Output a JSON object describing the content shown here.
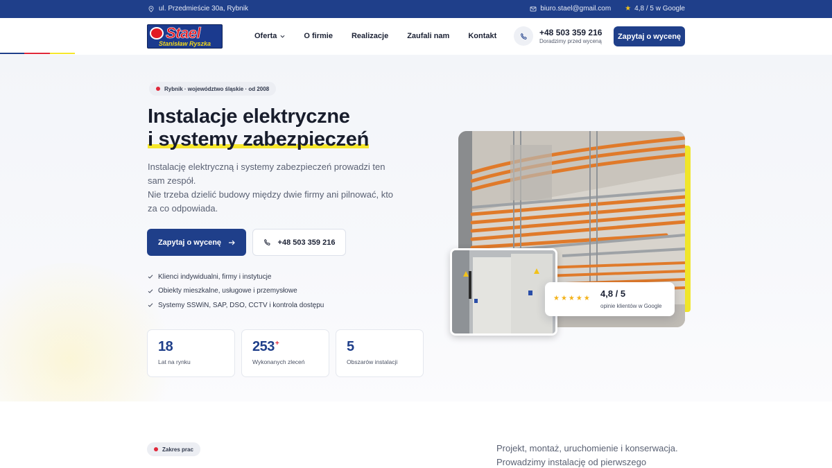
{
  "topbar": {
    "address": "ul. Przedmieście 30a, Rybnik",
    "email": "biuro.stael@gmail.com",
    "rating": "4,8 / 5 w Google"
  },
  "header": {
    "logo_word": "Stael",
    "logo_sub": "Stanisław Ryszka",
    "nav": [
      "Oferta",
      "O firmie",
      "Realizacje",
      "Zaufali nam",
      "Kontakt"
    ],
    "phone": "+48 503 359 216",
    "phone_hint": "Doradzimy przed wyceną",
    "cta": "Zapytaj o wycenę"
  },
  "colors": {
    "brand_blue": "#1f3f8a",
    "accent_red": "#e0283a",
    "accent_yellow": "#f6e72b"
  },
  "hero": {
    "badge": "Rybnik · województwo śląskie · od 2008",
    "title_line1": "Instalacje elektryczne",
    "title_line2": "i systemy zabezpieczeń",
    "lead_line1": "Instalację elektryczną i systemy zabezpieczeń prowadzi ten sam zespół.",
    "lead_line2": "Nie trzeba dzielić budowy między dwie firmy ani pilnować, kto za co odpowiada.",
    "cta": "Zapytaj o wycenę",
    "phone": "+48 503 359 216",
    "checks": [
      "Klienci indywidualni, firmy i instytucje",
      "Obiekty mieszkalne, usługowe i przemysłowe",
      "Systemy SSWiN, SAP, DSO, CCTV i kontrola dostępu"
    ],
    "stats": [
      {
        "value": "18",
        "suffix": "",
        "label": "Lat na rynku"
      },
      {
        "value": "253",
        "suffix": "+",
        "label": "Wykonanych zleceń"
      },
      {
        "value": "5",
        "suffix": "",
        "label": "Obszarów instalacji"
      }
    ],
    "rating_card": {
      "stars": "★★★★★",
      "score": "4,8 / 5",
      "caption": "opinie klientów w Google"
    }
  },
  "section2": {
    "badge": "Zakres prac",
    "text": "Projekt, montaż, uruchomienie i konserwacja. Prowadzimy instalację od pierwszego"
  }
}
